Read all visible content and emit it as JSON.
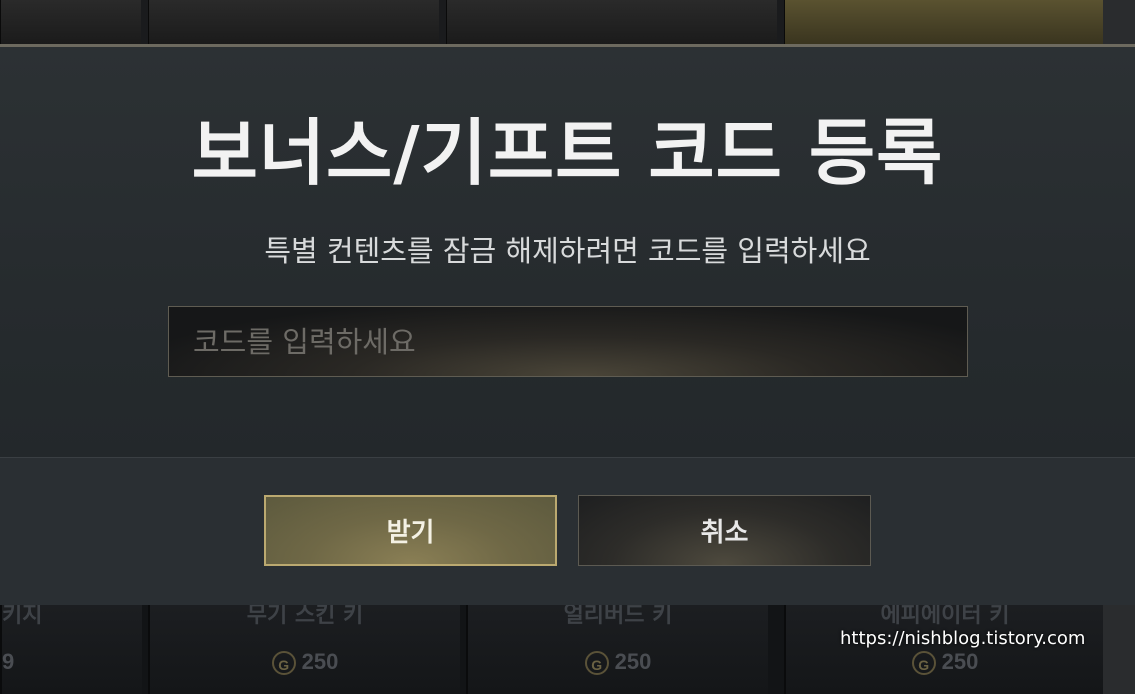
{
  "dialog": {
    "title": "보너스/기프트 코드 등록",
    "subtitle": "특별 컨텐츠를 잠금 해제하려면 코드를 입력하세요",
    "input_placeholder": "코드를 입력하세요",
    "input_value": "",
    "confirm_label": "받기",
    "cancel_label": "취소"
  },
  "background_store": {
    "cards": [
      {
        "name": "키지",
        "price": "9"
      },
      {
        "name": "무기 스킨 키",
        "price": "250"
      },
      {
        "name": "얼리버드 키",
        "price": "250"
      },
      {
        "name": "에피에이터 키",
        "price": "250"
      }
    ],
    "currency_symbol": "G"
  },
  "watermark": "https://nishblog.tistory.com",
  "colors": {
    "confirm_border": "#bba970",
    "modal_background": "#2a2f33"
  }
}
